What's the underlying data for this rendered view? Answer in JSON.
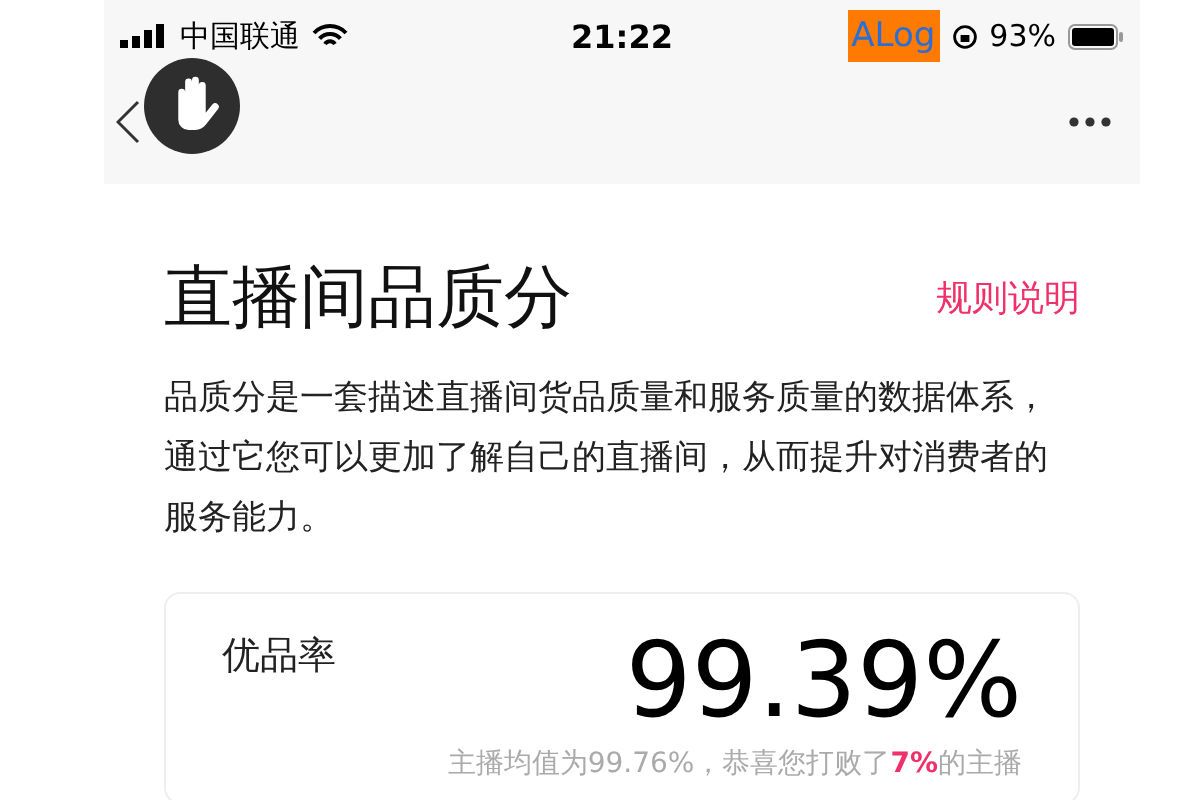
{
  "status_bar": {
    "carrier": "中国联通",
    "time": "21:22",
    "battery": "93%",
    "debug_badge": "ALog"
  },
  "header": {
    "title": "直播间品质分",
    "link": "规则说明",
    "description": "品质分是一套描述直播间货品质量和服务质量的数据体系，通过它您可以更加了解自己的直播间，从而提升对消费者的服务能力。"
  },
  "metric": {
    "label": "优品率",
    "value": "99.39%",
    "comparison": [
      {
        "text": "主播均值为99.76%，恭喜您打败了",
        "highlight": false
      },
      {
        "text": "7%",
        "highlight": true
      },
      {
        "text": "的主播",
        "highlight": false
      }
    ]
  }
}
